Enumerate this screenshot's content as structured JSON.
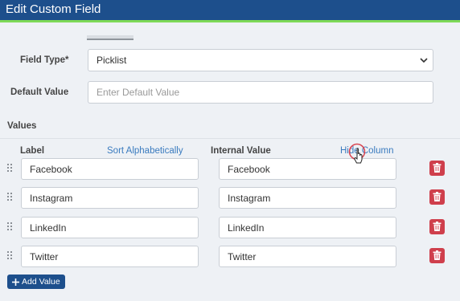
{
  "header": {
    "title": "Edit Custom Field"
  },
  "form": {
    "field_type_label": "Field Type*",
    "field_type_value": "Picklist",
    "default_value_label": "Default Value",
    "default_value_placeholder": "Enter Default Value"
  },
  "values_section": {
    "title": "Values",
    "label_header": "Label",
    "sort_link": "Sort Alphabetically",
    "internal_value_header": "Internal Value",
    "hide_column_link": "Hide Column",
    "rows": [
      {
        "label": "Facebook",
        "internal_value": "Facebook"
      },
      {
        "label": "Instagram",
        "internal_value": "Instagram"
      },
      {
        "label": "LinkedIn",
        "internal_value": "LinkedIn"
      },
      {
        "label": "Twitter",
        "internal_value": "Twitter"
      }
    ],
    "add_button": "Add Value",
    "add_icon": "plus-icon",
    "delete_icon": "trash-icon",
    "drag_icon": "drag-handle-icon"
  },
  "colors": {
    "header_bg": "#1d4f8c",
    "header_accent": "#7ed957",
    "link": "#3a7bbf",
    "delete_button": "#cf3f4c"
  }
}
